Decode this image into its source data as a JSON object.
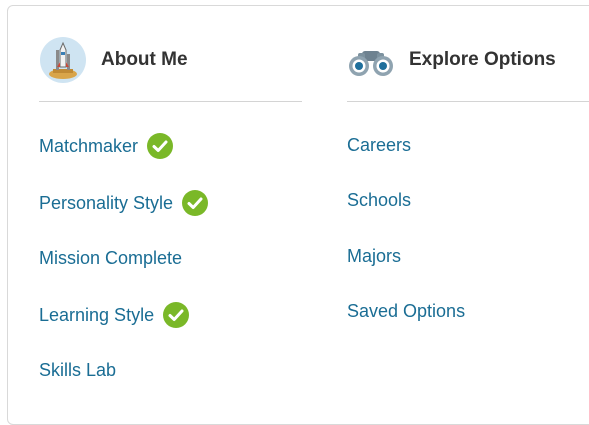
{
  "about": {
    "title": "About Me",
    "icon": "rocket-launch-icon",
    "items": [
      {
        "label": "Matchmaker",
        "completed": true
      },
      {
        "label": "Personality Style",
        "completed": true
      },
      {
        "label": "Mission Complete",
        "completed": false
      },
      {
        "label": "Learning Style",
        "completed": true
      },
      {
        "label": "Skills Lab",
        "completed": false
      }
    ]
  },
  "explore": {
    "title": "Explore Options",
    "icon": "binoculars-icon",
    "items": [
      {
        "label": "Careers"
      },
      {
        "label": "Schools"
      },
      {
        "label": "Majors"
      },
      {
        "label": "Saved Options"
      }
    ]
  },
  "colors": {
    "link": "#1a6d94",
    "heading": "#333333",
    "check": "#7ab828",
    "divider": "#d4d4d4"
  }
}
